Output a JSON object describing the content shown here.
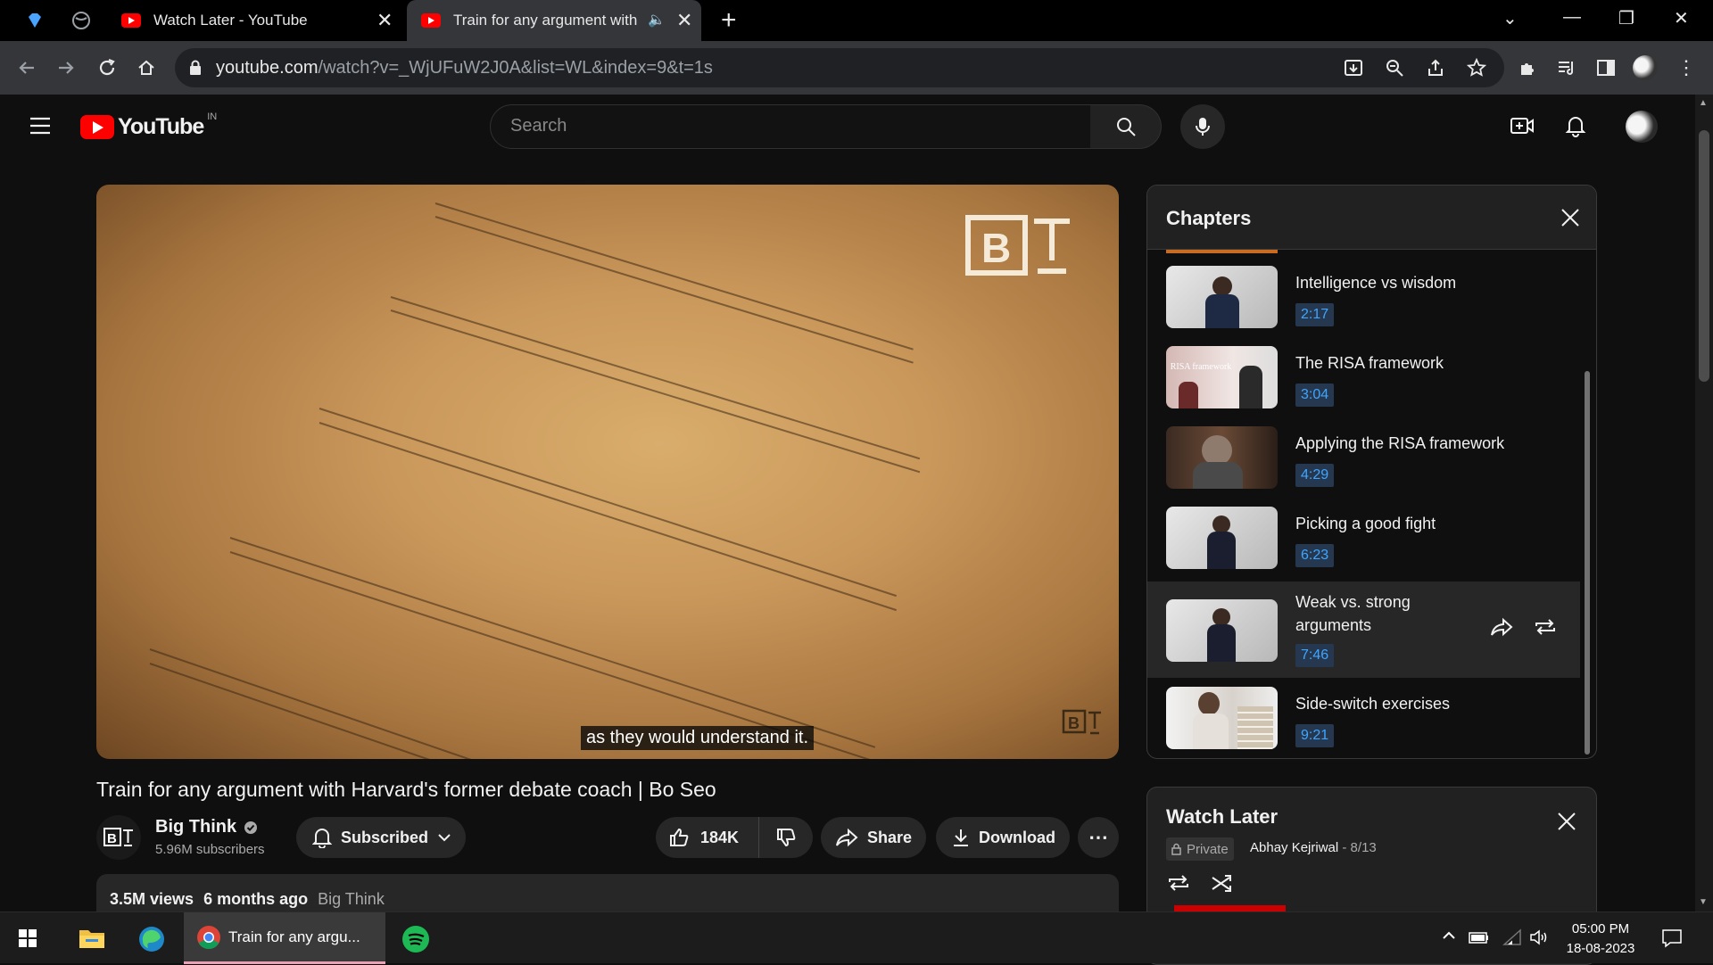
{
  "browser": {
    "tabs": [
      {
        "label": ""
      },
      {
        "label": "Watch Later - YouTube"
      },
      {
        "label": "Train for any argument with B"
      }
    ],
    "new_tab": "+",
    "url_domain": "youtube.com",
    "url_path": "/watch?v=_WjUFuW2J0A&list=WL&index=9&t=1s"
  },
  "youtube": {
    "logo_text": "YouTube",
    "region": "IN",
    "search_placeholder": "Search"
  },
  "video": {
    "caption": "as they would understand it.",
    "title": "Train for any argument with Harvard's former debate coach | Bo Seo",
    "channel": "Big Think",
    "subscribers": "5.96M subscribers",
    "subscribe_label": "Subscribed",
    "likes": "184K",
    "share_label": "Share",
    "download_label": "Download",
    "views": "3.5M views",
    "age": "6 months ago",
    "desc_channel": "Big Think",
    "watermark": "B T"
  },
  "chapters": {
    "heading": "Chapters",
    "items": [
      {
        "title": "Intelligence vs wisdom",
        "time": "2:17"
      },
      {
        "title": "The RISA framework",
        "time": "3:04"
      },
      {
        "title": "Applying the RISA framework",
        "time": "4:29"
      },
      {
        "title": "Picking a good fight",
        "time": "6:23"
      },
      {
        "title_line1": "Weak vs. strong",
        "title_line2": "arguments",
        "time": "7:46"
      },
      {
        "title": "Side-switch exercises",
        "time": "9:21"
      }
    ],
    "thumb_risa_text": "RISA framework"
  },
  "watch_later": {
    "heading": "Watch Later",
    "privacy": "Private",
    "owner": "Abhay Kejriwal",
    "position": "- 8/13"
  },
  "taskbar": {
    "active_app": "Train for any argu...",
    "time": "05:00 PM",
    "date": "18-08-2023"
  },
  "colors": {
    "youtube_red": "#ff0000",
    "chapter_time_blue": "#3ea6ff",
    "background": "#0f0f0f"
  }
}
